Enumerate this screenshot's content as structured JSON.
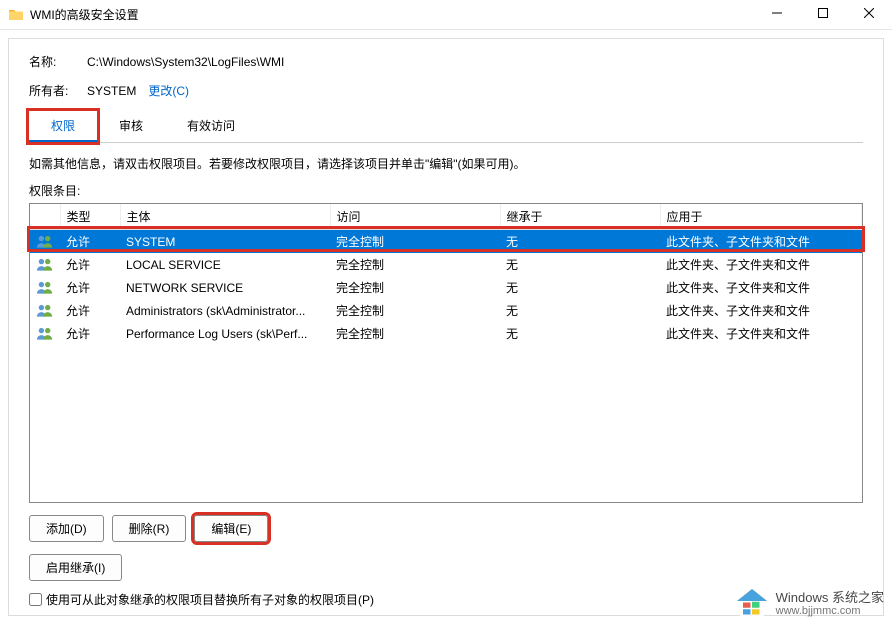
{
  "window": {
    "title": "WMI的高级安全设置"
  },
  "fields": {
    "name_label": "名称:",
    "name_value": "C:\\Windows\\System32\\LogFiles\\WMI",
    "owner_label": "所有者:",
    "owner_value": "SYSTEM",
    "change_link": "更改(C)"
  },
  "tabs": [
    {
      "label": "权限",
      "active": true
    },
    {
      "label": "审核",
      "active": false
    },
    {
      "label": "有效访问",
      "active": false
    }
  ],
  "help_text": "如需其他信息，请双击权限项目。若要修改权限项目，请选择该项目并单击\"编辑\"(如果可用)。",
  "section_label": "权限条目:",
  "columns": {
    "icon": "",
    "type": "类型",
    "principal": "主体",
    "access": "访问",
    "inherited_from": "继承于",
    "applies_to": "应用于"
  },
  "rows": [
    {
      "type": "允许",
      "principal": "SYSTEM",
      "access": "完全控制",
      "inherited_from": "无",
      "applies_to": "此文件夹、子文件夹和文件",
      "selected": true
    },
    {
      "type": "允许",
      "principal": "LOCAL SERVICE",
      "access": "完全控制",
      "inherited_from": "无",
      "applies_to": "此文件夹、子文件夹和文件",
      "selected": false
    },
    {
      "type": "允许",
      "principal": "NETWORK SERVICE",
      "access": "完全控制",
      "inherited_from": "无",
      "applies_to": "此文件夹、子文件夹和文件",
      "selected": false
    },
    {
      "type": "允许",
      "principal": "Administrators (sk\\Administrator...",
      "access": "完全控制",
      "inherited_from": "无",
      "applies_to": "此文件夹、子文件夹和文件",
      "selected": false
    },
    {
      "type": "允许",
      "principal": "Performance Log Users (sk\\Perf...",
      "access": "完全控制",
      "inherited_from": "无",
      "applies_to": "此文件夹、子文件夹和文件",
      "selected": false
    }
  ],
  "buttons": {
    "add": "添加(D)",
    "remove": "删除(R)",
    "edit": "编辑(E)",
    "enable_inherit": "启用继承(I)"
  },
  "checkbox_label": "使用可从此对象继承的权限项目替换所有子对象的权限项目(P)",
  "watermark": {
    "text": "Windows 系统之家",
    "url": "www.bjjmmc.com"
  }
}
